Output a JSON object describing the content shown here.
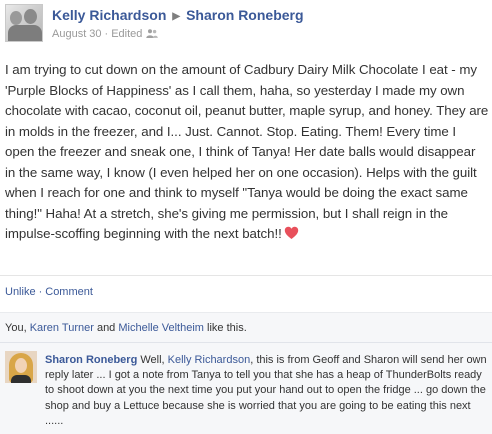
{
  "post": {
    "author": "Kelly Richardson",
    "target": "Sharon Roneberg",
    "date": "August 30",
    "edited": "Edited",
    "sep": "·",
    "body": "I am trying to cut down on the amount of Cadbury Dairy Milk Chocolate I eat - my 'Purple Blocks of Happiness' as I call them, haha, so yesterday I made my own chocolate with cacao, coconut oil, peanut butter, maple syrup, and honey. They are in molds in the freezer, and I... Just. Cannot. Stop. Eating. Them! Every time I open the freezer and sneak one, I think of Tanya! Her date balls would disappear in the same way, I know (I even helped her on one occasion). Helps with the guilt when I reach for one and think to myself \"Tanya would be doing the exact same thing!\" Haha! At a stretch, she's giving me permission, but I shall reign in the impulse-scoffing beginning with the next batch!!"
  },
  "actions": {
    "unlike": "Unlike",
    "dot": "·",
    "comment": "Comment"
  },
  "likes": {
    "prefix": "You, ",
    "person1": "Karen Turner",
    "and": " and ",
    "person2": "Michelle Veltheim",
    "suffix": " like this."
  },
  "comment": {
    "author": "Sharon Roneberg",
    "text_before": " Well, ",
    "mention": "Kelly Richardson",
    "text_after": ", this is from Geoff and Sharon will send her own reply later ... I got a note from Tanya to tell you that she has a heap of ThunderBolts ready to shoot down at you the next time you put your hand out to open the fridge ... go down the shop and buy a Lettuce because she is worried that you are going to be eating this next ......"
  },
  "icons": {
    "friends": "friends-audience-icon",
    "heart": "heart-emoji-icon",
    "arrow": "share-arrow-icon"
  },
  "colors": {
    "link": "#3b5998",
    "meta": "#999999",
    "heart": "#e8505b",
    "panel": "#f6f7f9"
  }
}
